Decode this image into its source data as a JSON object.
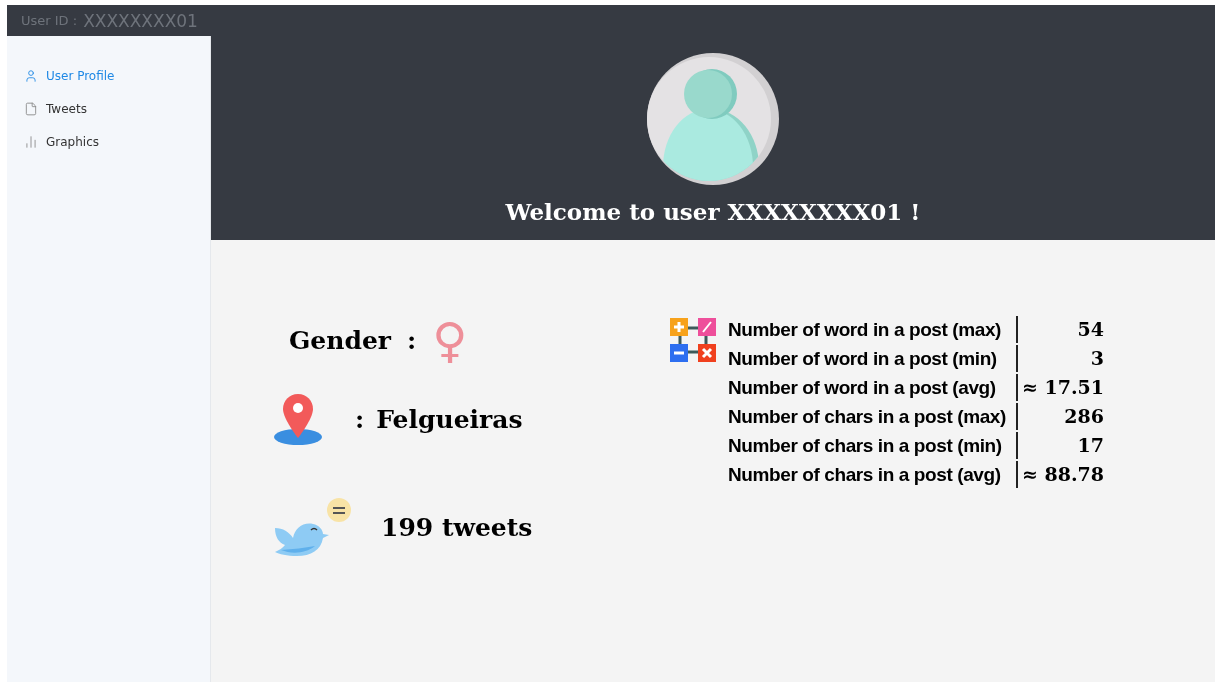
{
  "top_bar": {
    "label": "User ID :",
    "user_id": "XXXXXXXX01"
  },
  "sidebar": {
    "items": [
      {
        "label": "User Profile",
        "selected": true
      },
      {
        "label": "Tweets",
        "selected": false
      },
      {
        "label": "Graphics",
        "selected": false
      }
    ]
  },
  "header": {
    "welcome": "Welcome to user XXXXXXXX01 !"
  },
  "profile": {
    "gender_label": "Gender",
    "gender_separator": ":",
    "gender": "♀",
    "location_separator": ":",
    "location": "Felgueiras",
    "tweets": "199 tweets"
  },
  "stats": [
    {
      "label": "Number of word in a post (max)",
      "value": "54"
    },
    {
      "label": "Number of word in a post (min)",
      "value": "3"
    },
    {
      "label": "Number of word in a post (avg)",
      "value": "≈ 17.51"
    },
    {
      "label": "Number of chars in a post (max)",
      "value": "286"
    },
    {
      "label": "Number of chars in a post (min)",
      "value": "17"
    },
    {
      "label": "Number of chars in a post (avg)",
      "value": "≈ 88.78"
    }
  ]
}
